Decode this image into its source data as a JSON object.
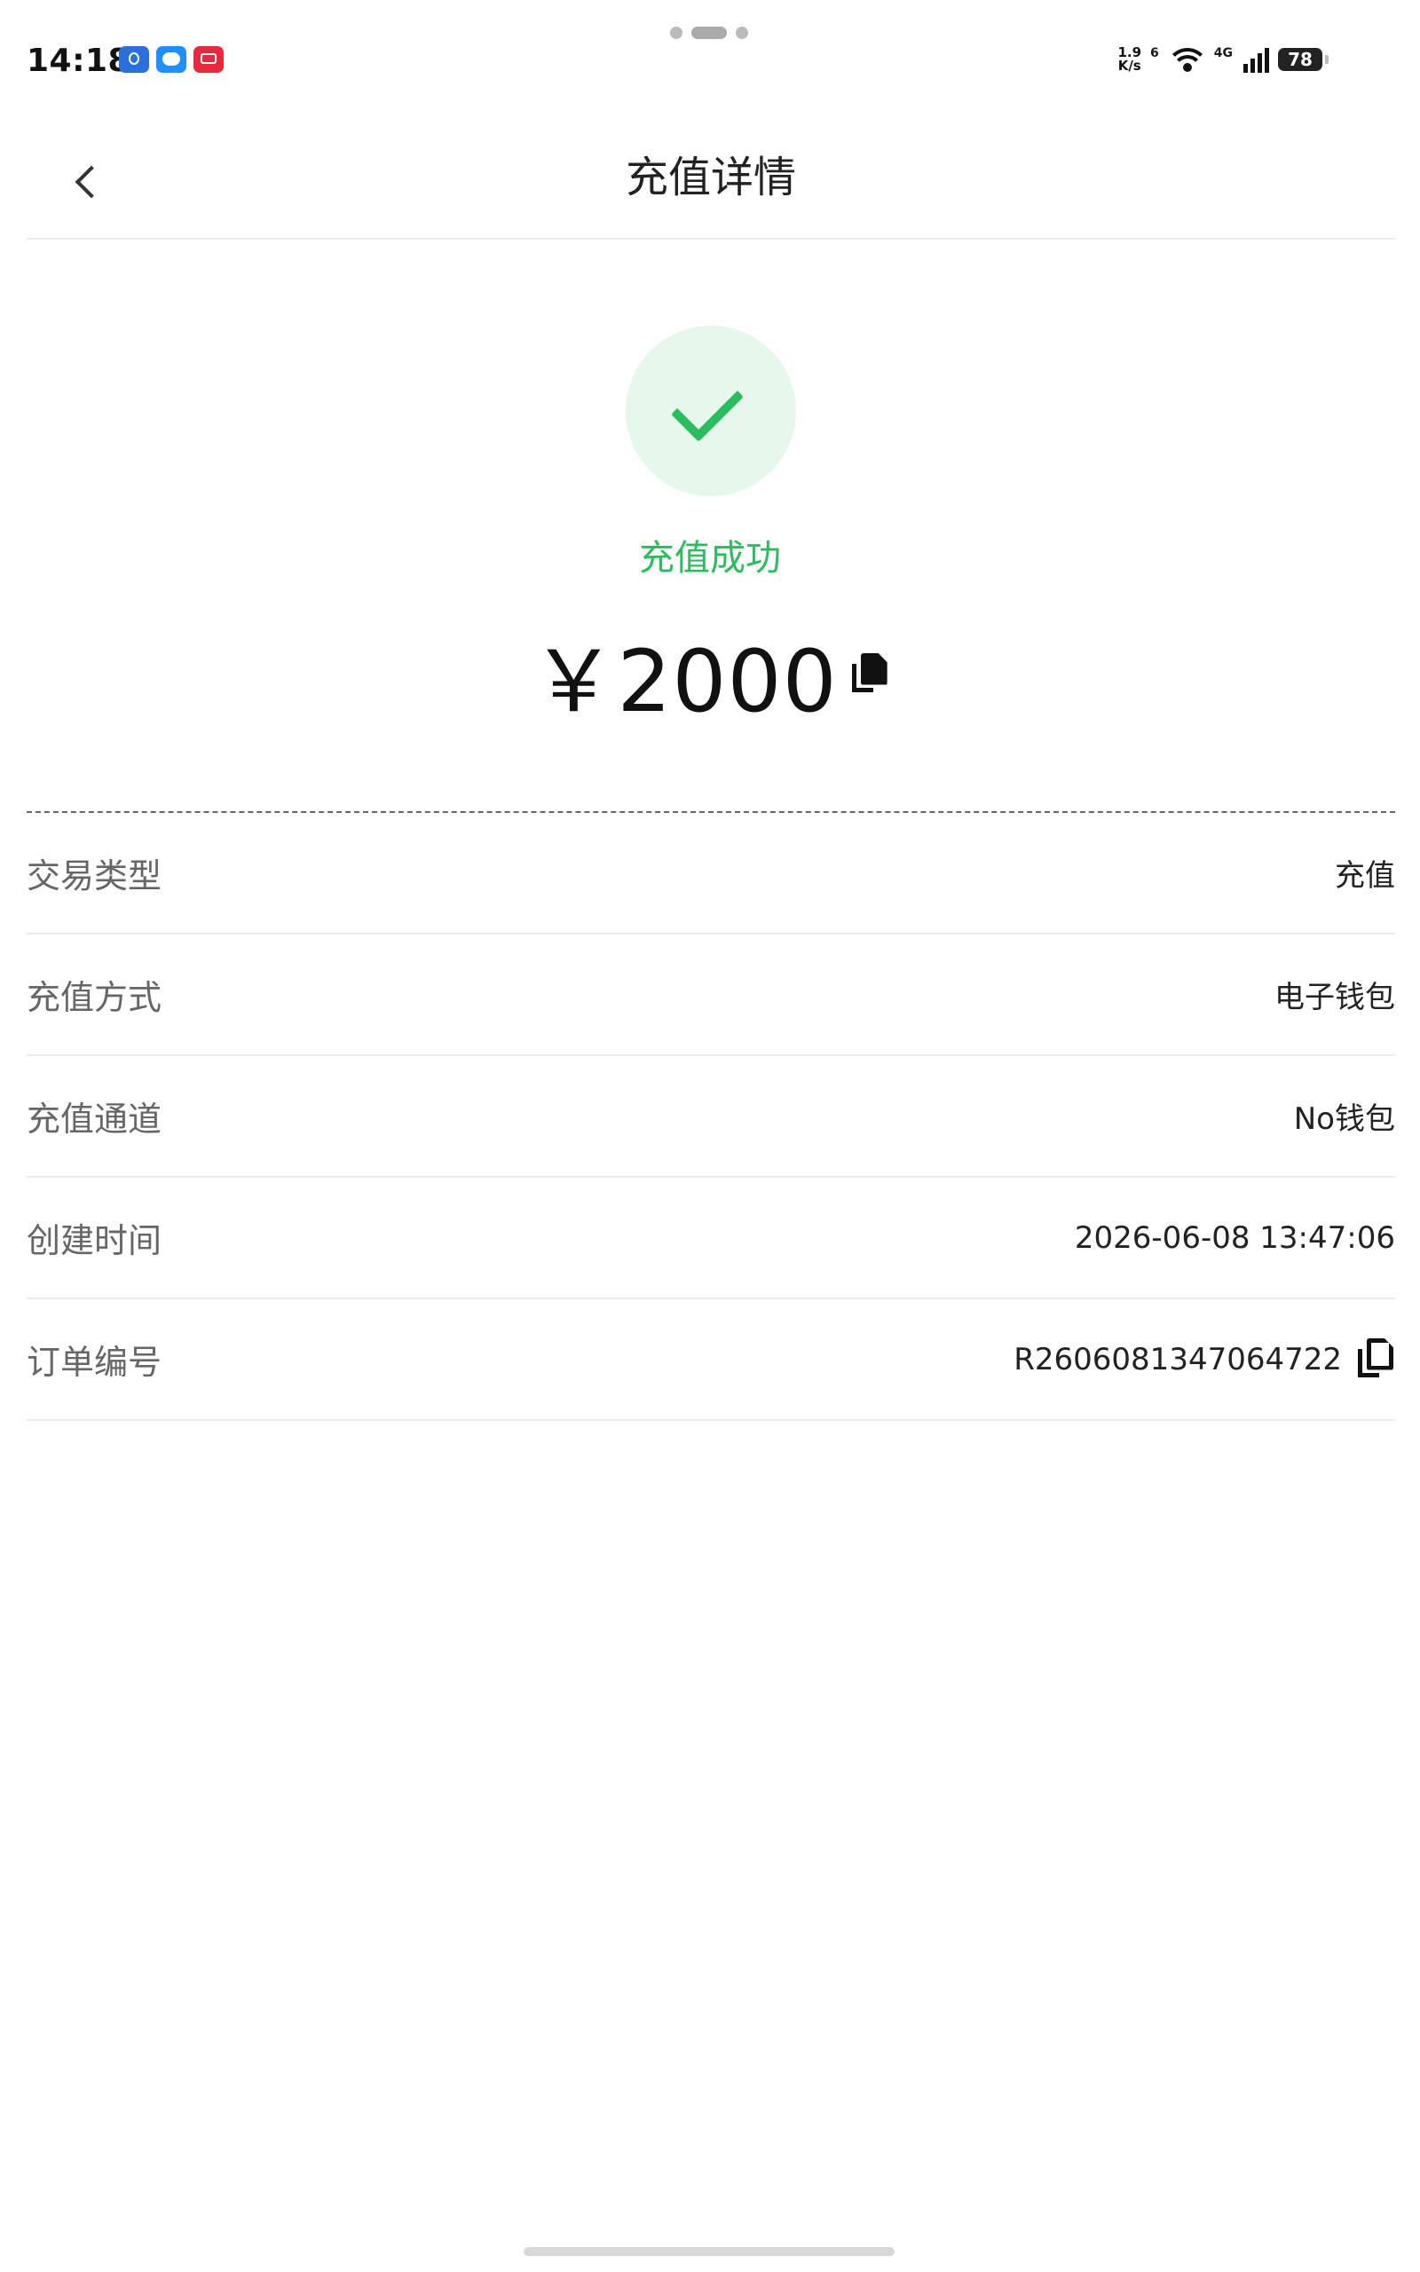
{
  "status_bar": {
    "time": "14:18",
    "net_speed_value": "1.9",
    "net_speed_unit": "K/s",
    "wifi_label": "6",
    "signal_label": "4G",
    "battery": "78"
  },
  "header": {
    "title": "充值详情"
  },
  "result": {
    "status": "充值成功",
    "amount": "￥2000",
    "status_color": "#2bbd5d"
  },
  "details": [
    {
      "label": "交易类型",
      "value": "充值"
    },
    {
      "label": "充值方式",
      "value": "电子钱包"
    },
    {
      "label": "充值通道",
      "value": "No钱包"
    },
    {
      "label": "创建时间",
      "value": "2026-06-08 13:47:06"
    },
    {
      "label": "订单编号",
      "value": "R2606081347064722"
    }
  ],
  "icons": [
    "back-arrow-icon",
    "checkmark-icon",
    "copy-icon"
  ]
}
